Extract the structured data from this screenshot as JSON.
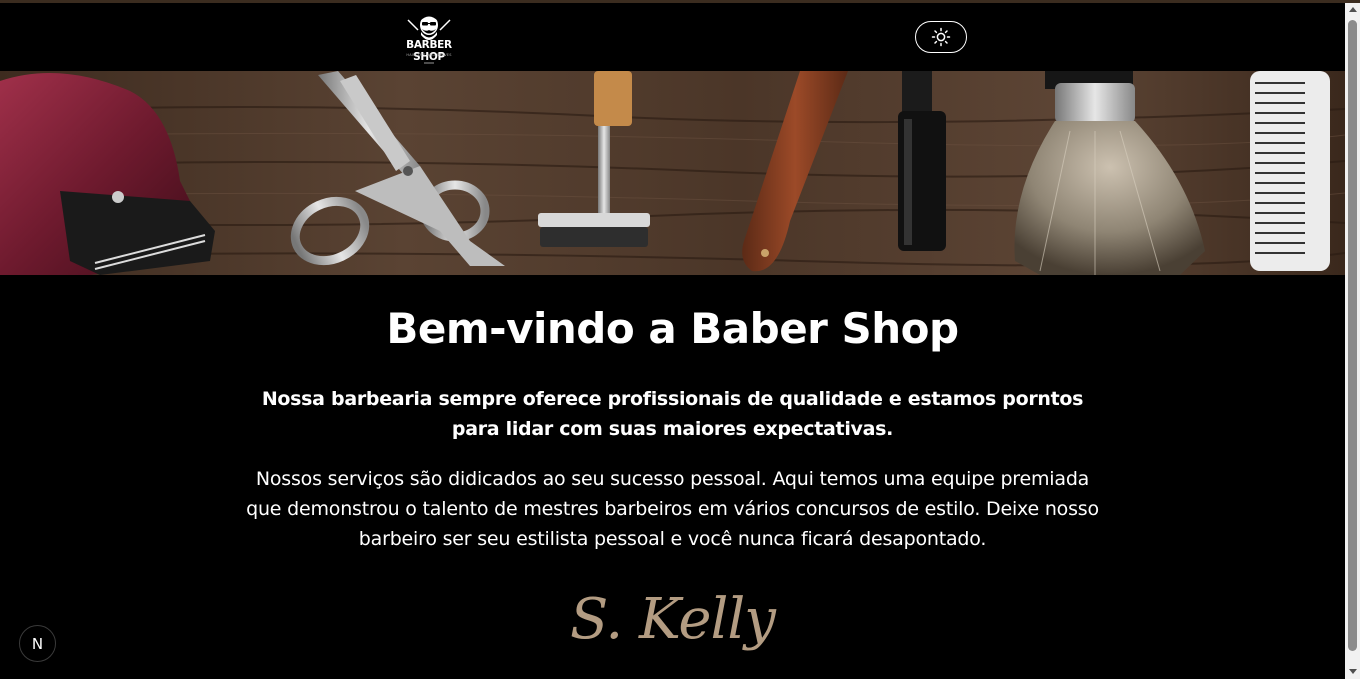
{
  "header": {
    "logo": {
      "text": "BARBER SHOP",
      "tagline": "HAIRCUTS AND SHAVES",
      "icon": "barber-face-logo"
    },
    "theme_toggle": {
      "icon": "sun-icon"
    }
  },
  "hero": {
    "description_icon": "barber-tools-banner"
  },
  "main": {
    "title": "Bem-vindo a Baber Shop",
    "lead": "Nossa barbearia sempre oferece profissionais de qualidade e estamos pornto​s para lidar com suas maiores expectativas.",
    "body": "Nossos serviços são didicados ao seu sucesso pessoal. Aqui temos uma equipe premiada que demonstrou o talento de mestres barbeiros em vários concursos de estilo. Deixe nosso barbeiro ser seu estilista pessoal e você nunca ficará desapontado.",
    "signature": "S. Kelly"
  },
  "dev_badge": {
    "label": "N"
  },
  "colors": {
    "background": "#000000",
    "text": "#ffffff",
    "signature": "#b39c82",
    "wood": "#4a3626"
  }
}
